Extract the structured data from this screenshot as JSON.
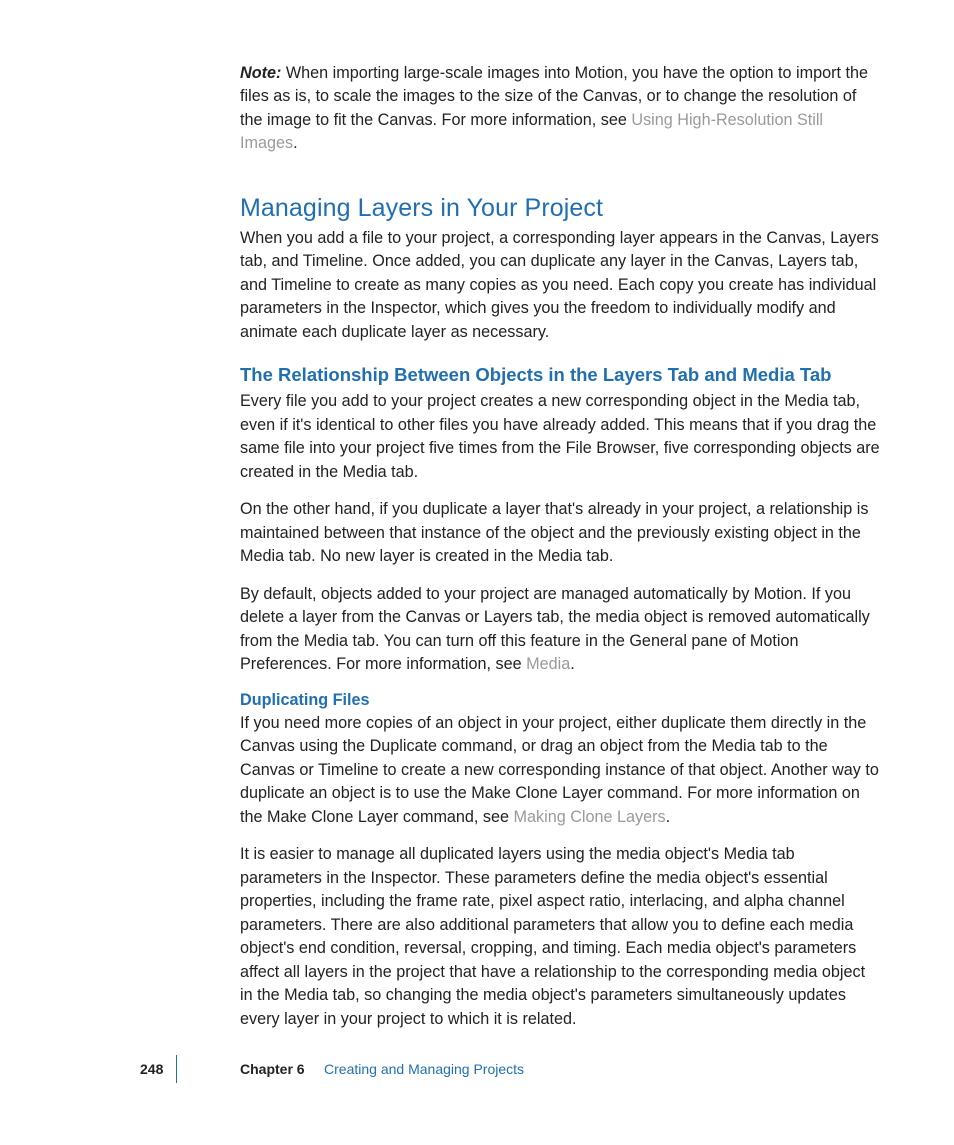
{
  "note": {
    "label": "Note:",
    "body_before_link": "When importing large-scale images into Motion, you have the option to import the files as is, to scale the images to the size of the Canvas, or to change the resolution of the image to fit the Canvas. For more information, see ",
    "link": "Using High-Resolution Still Images",
    "after_link": "."
  },
  "h1": "Managing Layers in Your Project",
  "p1": "When you add a file to your project, a corresponding layer appears in the Canvas, Layers tab, and Timeline. Once added, you can duplicate any layer in the Canvas, Layers tab, and Timeline to create as many copies as you need. Each copy you create has individual parameters in the Inspector, which gives you the freedom to individually modify and animate each duplicate layer as necessary.",
  "h2": "The Relationship Between Objects in the Layers Tab and Media Tab",
  "p2": "Every file you add to your project creates a new corresponding object in the Media tab, even if it's identical to other files you have already added. This means that if you drag the same file into your project five times from the File Browser, five corresponding objects are created in the Media tab.",
  "p3": "On the other hand, if you duplicate a layer that's already in your project, a relationship is maintained between that instance of the object and the previously existing object in the Media tab. No new layer is created in the Media tab.",
  "p4_before": "By default, objects added to your project are managed automatically by Motion. If you delete a layer from the Canvas or Layers tab, the media object is removed automatically from the Media tab. You can turn off this feature in the General pane of Motion Preferences. For more information, see ",
  "p4_link": "Media",
  "p4_after": ".",
  "h3": "Duplicating Files",
  "p5_before": "If you need more copies of an object in your project, either duplicate them directly in the Canvas using the Duplicate command, or drag an object from the Media tab to the Canvas or Timeline to create a new corresponding instance of that object. Another way to duplicate an object is to use the Make Clone Layer command. For more information on the Make Clone Layer command, see ",
  "p5_link": "Making Clone Layers",
  "p5_after": ".",
  "p6": "It is easier to manage all duplicated layers using the media object's Media tab parameters in the Inspector. These parameters define the media object's essential properties, including the frame rate, pixel aspect ratio, interlacing, and alpha channel parameters. There are also additional parameters that allow you to define each media object's end condition, reversal, cropping, and timing. Each media object's parameters affect all layers in the project that have a relationship to the corresponding media object in the Media tab, so changing the media object's parameters simultaneously updates every layer in your project to which it is related.",
  "footer": {
    "page": "248",
    "chapter_label": "Chapter 6",
    "chapter_title": "Creating and Managing Projects"
  }
}
